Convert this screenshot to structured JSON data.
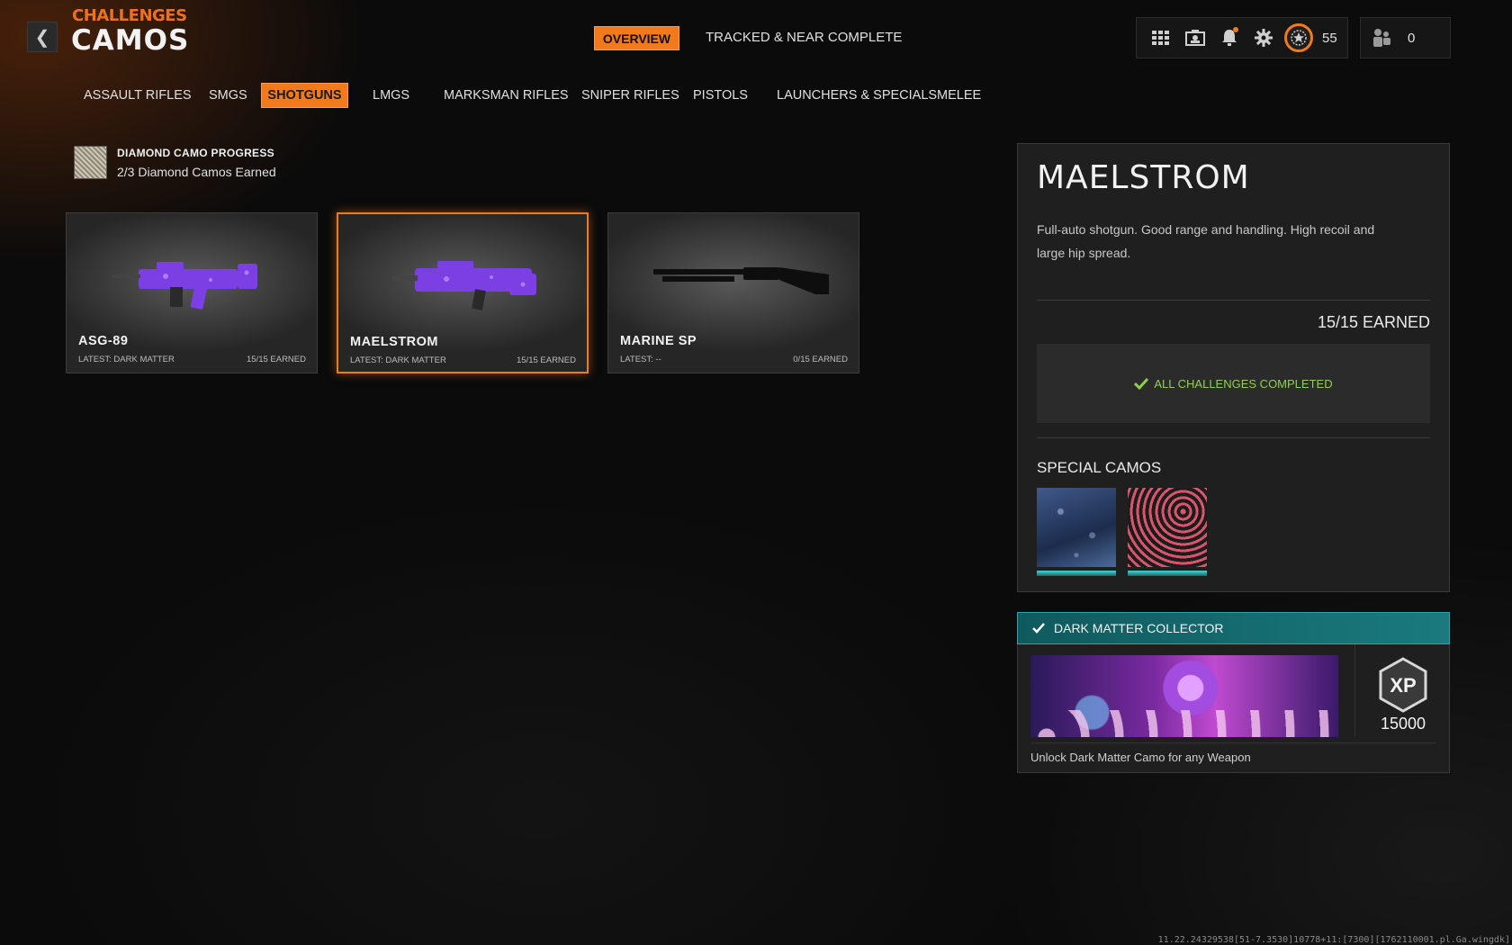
{
  "header": {
    "section_label": "CHALLENGES",
    "title": "CAMOS",
    "back_icon": "chevron-left-icon",
    "tabs": [
      {
        "label": "OVERVIEW",
        "active": true
      },
      {
        "label": "TRACKED & NEAR COMPLETE",
        "active": false
      }
    ],
    "icons": [
      "grid-icon",
      "id-card-icon",
      "bell-icon",
      "gear-icon"
    ],
    "level": "55",
    "friends_count": "0"
  },
  "categories": [
    {
      "label": "ASSAULT RIFLES",
      "active": false
    },
    {
      "label": "SMGS",
      "active": false
    },
    {
      "label": "SHOTGUNS",
      "active": true
    },
    {
      "label": "LMGS",
      "active": false
    },
    {
      "label": "MARKSMAN RIFLES",
      "active": false
    },
    {
      "label": "SNIPER RIFLES",
      "active": false
    },
    {
      "label": "PISTOLS",
      "active": false
    },
    {
      "label": "LAUNCHERS & SPECIALS",
      "active": false
    },
    {
      "label": "MELEE",
      "active": false
    }
  ],
  "diamond_progress": {
    "heading": "DIAMOND CAMO PROGRESS",
    "count": "2/3 Diamond Camos Earned"
  },
  "weapons": [
    {
      "name": "ASG-89",
      "latest": "LATEST: DARK MATTER",
      "earned": "15/15 EARNED",
      "selected": false
    },
    {
      "name": "MAELSTROM",
      "latest": "LATEST: DARK MATTER",
      "earned": "15/15 EARNED",
      "selected": true
    },
    {
      "name": "MARINE SP",
      "latest": "LATEST: --",
      "earned": "0/15 EARNED",
      "selected": false
    }
  ],
  "details": {
    "title": "MAELSTROM",
    "description": "Full-auto shotgun.  Good range and handling. High recoil and large hip spread.",
    "earned_total": "15/15 EARNED",
    "complete_text": "ALL CHALLENGES COMPLETED",
    "special_heading": "SPECIAL CAMOS"
  },
  "reward": {
    "title": "DARK MATTER COLLECTOR",
    "xp_label": "XP",
    "xp_value": "15000",
    "description": "Unlock Dark Matter Camo for any Weapon"
  },
  "build_string": "11.22.24329538[51-7.3530]10778+11:[7300][1762110001.pl.Ga.wingdk]",
  "colors": {
    "accent": "#f07a1c",
    "complete_green": "#8fd14f",
    "reward_teal": "#1a7a7e",
    "camo_purple": "#7b3fe4"
  }
}
